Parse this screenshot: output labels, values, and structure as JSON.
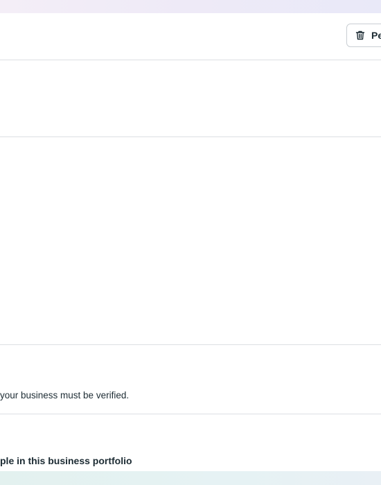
{
  "header": {
    "delete_button_label": "Pe"
  },
  "verification": {
    "text": "your business must be verified."
  },
  "people": {
    "heading": "ple in this business portfolio"
  },
  "colors": {
    "divider": "#dcdfe3",
    "text": "#1c2b33",
    "button_border": "#c9ced3"
  },
  "icons": {
    "delete_button_icon": "trash-icon"
  }
}
